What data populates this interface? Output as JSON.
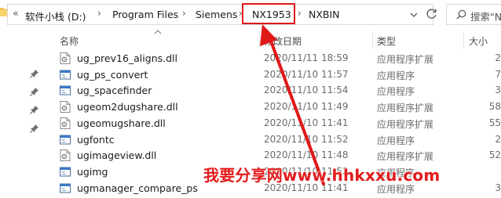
{
  "address_bar": {
    "overflow_label": "«",
    "crumbs": [
      "软件小栈 (D:)",
      "Program Files",
      "Siemens",
      "NX1953",
      "NXBIN"
    ],
    "separator": "›",
    "highlighted_crumb": "NX1953"
  },
  "search": {
    "placeholder": "搜索\"N"
  },
  "columns": {
    "name": "名称",
    "date": "修改日期",
    "type": "类型",
    "size": "大小"
  },
  "files": [
    {
      "name": "ug_prev16_aligns.dll",
      "date": "2020/11/11 18:59",
      "type": "应用程序扩展",
      "size": "2",
      "icon": "dll-icon"
    },
    {
      "name": "ug_ps_convert",
      "date": "2020/11/10 11:57",
      "type": "应用程序",
      "size": "7",
      "icon": "exe-icon"
    },
    {
      "name": "ug_spacefinder",
      "date": "2020/11/10 11:54",
      "type": "应用程序",
      "size": "3",
      "icon": "exe-icon"
    },
    {
      "name": "ugeom2dugshare.dll",
      "date": "2020/11/10 11:49",
      "type": "应用程序扩展",
      "size": "58",
      "icon": "dll-icon"
    },
    {
      "name": "ugeomugshare.dll",
      "date": "2020/11/10 11:41",
      "type": "应用程序扩展",
      "size": "55",
      "icon": "dll-icon"
    },
    {
      "name": "ugfontc",
      "date": "2020/11/10 11:52",
      "type": "应用程序",
      "size": "2",
      "icon": "exe-icon"
    },
    {
      "name": "ugimageview.dll",
      "date": "2020/11/10 11:48",
      "type": "应用程序扩展",
      "size": "52",
      "icon": "dll-icon"
    },
    {
      "name": "ugimg",
      "date": "2020/11/10 11:52",
      "type": "应用程序",
      "size": "",
      "icon": "exe-icon"
    },
    {
      "name": "ugmanager_compare_ps",
      "date": "2020/11/10 11:41",
      "type": "应用程序",
      "size": "3",
      "icon": "exe-icon"
    }
  ],
  "watermark": "我要分享网www.hhkxxu.com",
  "colors": {
    "highlight": "#e01818",
    "watermark": "#e41b1b",
    "selection": "#cce8ff"
  }
}
